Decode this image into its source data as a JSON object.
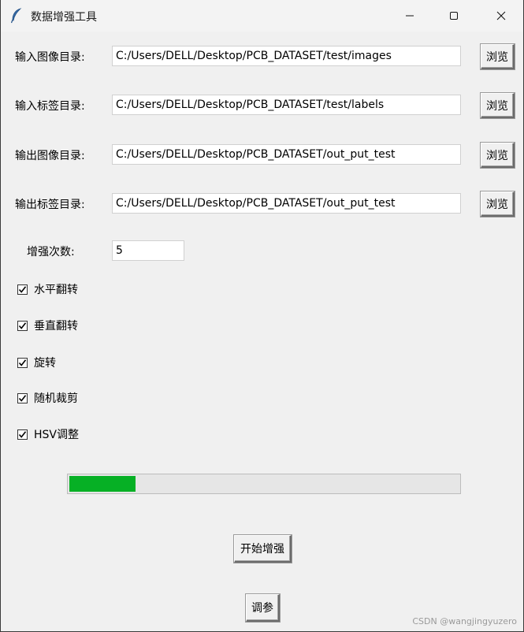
{
  "window": {
    "title": "数据增强工具",
    "controls": [
      "minimize",
      "maximize",
      "close"
    ]
  },
  "paths": [
    {
      "label": "输入图像目录:",
      "value": "C:/Users/DELL/Desktop/PCB_DATASET/test/images",
      "browse": "浏览"
    },
    {
      "label": "输入标签目录:",
      "value": "C:/Users/DELL/Desktop/PCB_DATASET/test/labels",
      "browse": "浏览"
    },
    {
      "label": "输出图像目录:",
      "value": "C:/Users/DELL/Desktop/PCB_DATASET/out_put_test",
      "browse": "浏览"
    },
    {
      "label": "输出标签目录:",
      "value": "C:/Users/DELL/Desktop/PCB_DATASET/out_put_test",
      "browse": "浏览"
    }
  ],
  "augment_count": {
    "label": "增强次数:",
    "value": "5"
  },
  "options": [
    {
      "label": "水平翻转",
      "checked": true
    },
    {
      "label": "垂直翻转",
      "checked": true
    },
    {
      "label": "旋转",
      "checked": true
    },
    {
      "label": "随机裁剪",
      "checked": true
    },
    {
      "label": "HSV调整",
      "checked": true
    }
  ],
  "progress": {
    "fraction": 0.17,
    "color": "#06b025"
  },
  "actions": {
    "start_label": "开始增强",
    "tune_label": "调参"
  },
  "watermark": "CSDN @wangjingyuzero"
}
